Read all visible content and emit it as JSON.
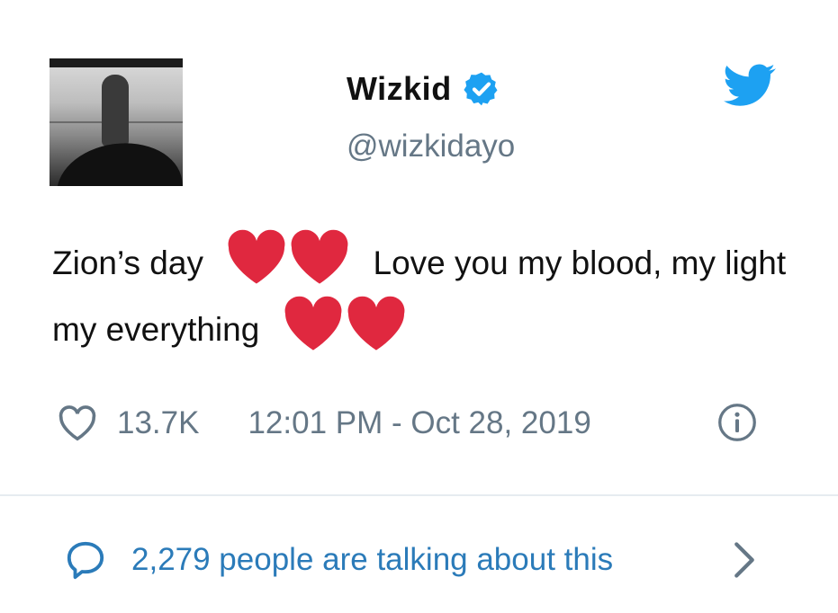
{
  "author": {
    "name": "Wizkid",
    "handle": "@wizkidayo",
    "verified": true
  },
  "tweet": {
    "text_part1": "Zion’s day",
    "text_part2": "Love you my blood, my light my everything"
  },
  "meta": {
    "likes": "13.7K",
    "timestamp": "12:01 PM - Oct 28, 2019"
  },
  "footer": {
    "talking": "2,279 people are talking about this"
  },
  "icons": {
    "brand": "twitter-bird-icon",
    "verified": "verified-badge-icon",
    "like": "heart-outline-icon",
    "info": "info-icon",
    "reply": "speech-bubble-icon",
    "more": "chevron-right-icon"
  },
  "colors": {
    "twitter_blue": "#1da1f2",
    "link_blue": "#2b7bb9",
    "gray": "#657786",
    "heart_red": "#e0283f"
  }
}
